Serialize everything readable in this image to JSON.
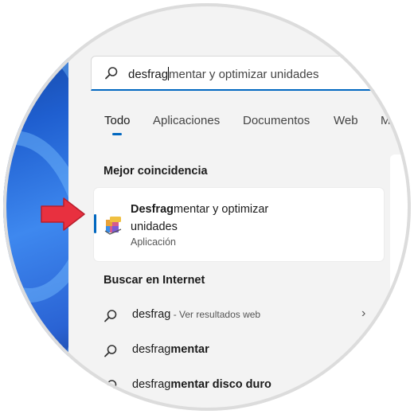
{
  "search": {
    "typed": "desfrag",
    "suggestion_rest": "mentar y optimizar unidades"
  },
  "tabs": [
    {
      "label": "Todo",
      "active": true
    },
    {
      "label": "Aplicaciones"
    },
    {
      "label": "Documentos"
    },
    {
      "label": "Web"
    },
    {
      "label": "M"
    }
  ],
  "best_match": {
    "heading": "Mejor coincidencia",
    "title_bold": "Desfrag",
    "title_rest_line1": "mentar y optimizar",
    "title_line2": "unidades",
    "subtitle": "Aplicación",
    "icon": "defrag-app-icon"
  },
  "web": {
    "heading": "Buscar en Internet",
    "results": [
      {
        "term": "desfrag",
        "rest": "",
        "hint": " - Ver resultados web",
        "icon": "search-icon",
        "has_chevron": true
      },
      {
        "term": "desfrag",
        "rest": "mentar",
        "hint": "",
        "icon": "search-icon",
        "has_chevron": false
      },
      {
        "term": "desfrag",
        "rest": "mentar disco duro",
        "hint": "",
        "icon": "search-icon",
        "has_chevron": false
      }
    ]
  },
  "colors": {
    "accent": "#0067c0",
    "arrow": "#e8303f",
    "panel_bg": "#f3f3f3"
  }
}
